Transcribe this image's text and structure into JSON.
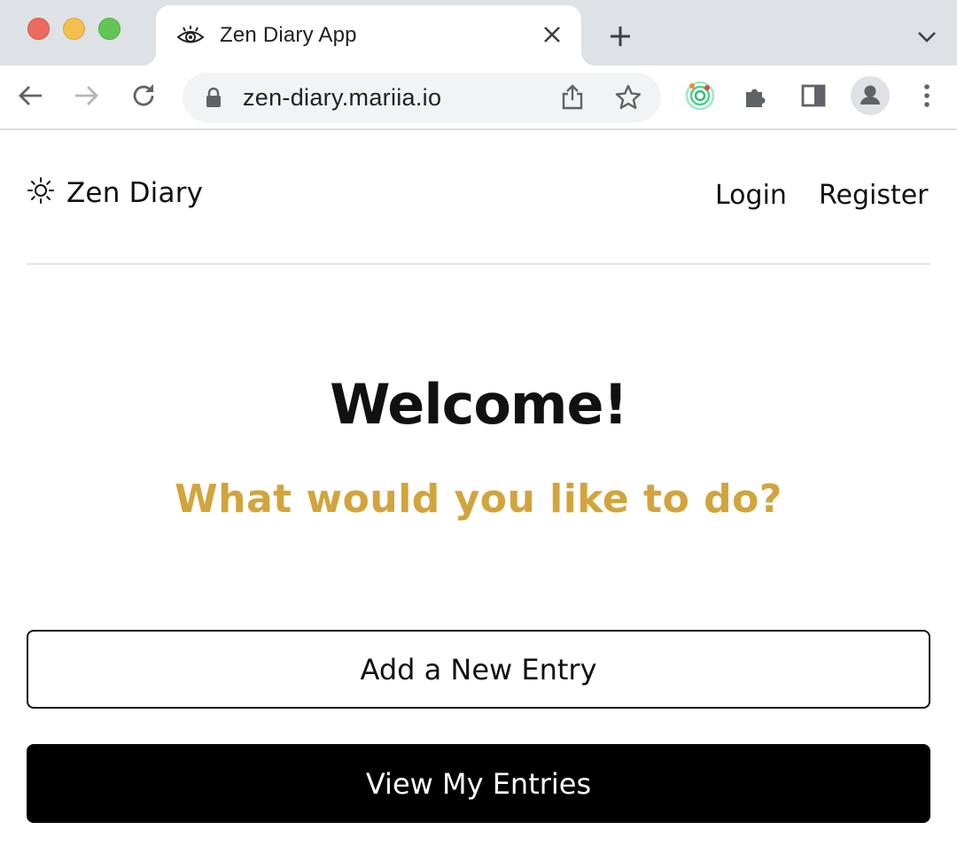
{
  "browser": {
    "tab": {
      "title": "Zen Diary App",
      "favicon": "eye-icon"
    },
    "address_bar": {
      "url": "zen-diary.mariia.io"
    },
    "icons": [
      "back-icon",
      "forward-icon",
      "reload-icon",
      "lock-icon",
      "share-icon",
      "star-icon",
      "extension-target-icon",
      "puzzle-icon",
      "side-panel-icon",
      "profile-avatar-icon",
      "menu-icon"
    ]
  },
  "header": {
    "brand_name": "Zen Diary",
    "brand_icon": "sun-icon",
    "nav": {
      "login": "Login",
      "register": "Register"
    }
  },
  "hero": {
    "title": "Welcome!",
    "subtitle": "What would you like to do?"
  },
  "actions": {
    "add_entry": "Add a New Entry",
    "view_entries": "View My Entries"
  },
  "colors": {
    "accent": "#d2a43c",
    "primary_button_bg": "#000000",
    "tab_strip": "#dee1e6"
  }
}
